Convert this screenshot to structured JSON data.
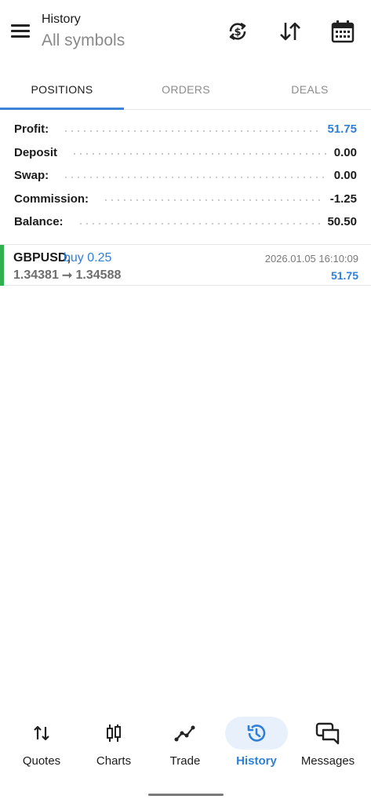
{
  "header": {
    "title": "History",
    "subtitle": "All symbols",
    "icons": [
      "currency-refresh-icon",
      "sort-icon",
      "calendar-icon"
    ]
  },
  "tabs": [
    {
      "label": "POSITIONS",
      "active": true
    },
    {
      "label": "ORDERS",
      "active": false
    },
    {
      "label": "DEALS",
      "active": false
    }
  ],
  "summary": [
    {
      "label": "Profit:",
      "value": "51.75",
      "highlight": true
    },
    {
      "label": "Deposit",
      "value": "0.00",
      "highlight": false
    },
    {
      "label": "Swap:",
      "value": "0.00",
      "highlight": false
    },
    {
      "label": "Commission:",
      "value": "-1.25",
      "highlight": false
    },
    {
      "label": "Balance:",
      "value": "50.50",
      "highlight": false
    }
  ],
  "position": {
    "symbol": "GBPUSD,",
    "side": "buy 0.25",
    "prices": "1.34381 ⭢ 1.34588",
    "time": "2026.01.05 16:10:09",
    "profit": "51.75",
    "side_color": "#2fb14f"
  },
  "bottom_nav": [
    {
      "label": "Quotes",
      "icon": "quotes-arrows-icon",
      "active": false
    },
    {
      "label": "Charts",
      "icon": "candlestick-icon",
      "active": false
    },
    {
      "label": "Trade",
      "icon": "trade-line-icon",
      "active": false
    },
    {
      "label": "History",
      "icon": "history-clock-icon",
      "active": true
    },
    {
      "label": "Messages",
      "icon": "messages-icon",
      "active": false
    }
  ],
  "colors": {
    "accent": "#2f7fd6",
    "buy_bar": "#2fb14f",
    "muted": "#8a8a8a"
  }
}
